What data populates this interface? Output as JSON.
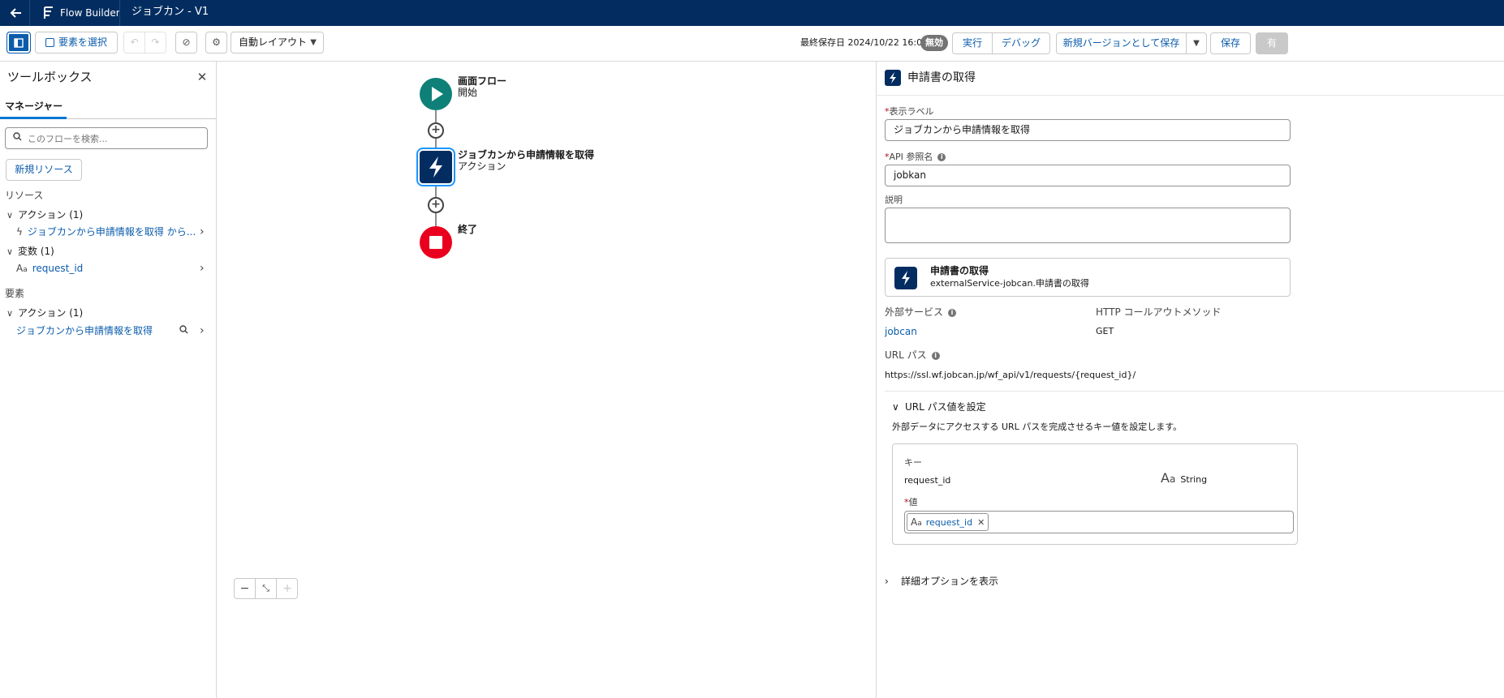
{
  "header": {
    "back_icon": "arrow-left-icon",
    "app_name": "Flow Builder",
    "flow_title": "ジョブカン - V1"
  },
  "toolbar": {
    "select_elements": "要素を選択",
    "layout_mode": "自動レイアウト",
    "last_saved": "最終保存日 2024/10/22 16:04",
    "status_badge": "無効",
    "run": "実行",
    "debug": "デバッグ",
    "save_as_new_version": "新規バージョンとして保存",
    "save": "保存",
    "activate": "有"
  },
  "toolbox": {
    "title": "ツールボックス",
    "tab_manager": "マネージャー",
    "search_placeholder": "このフローを検索...",
    "new_resource": "新規リソース",
    "resources_label": "リソース",
    "resource_groups": [
      {
        "label": "アクション (1)",
        "items": [
          {
            "label": "ジョブカンから申請情報を取得 から..."
          }
        ]
      },
      {
        "label": "変数 (1)",
        "items": [
          {
            "label": "request_id"
          }
        ]
      }
    ],
    "elements_label": "要素",
    "element_groups": [
      {
        "label": "アクション (1)",
        "items": [
          {
            "label": "ジョブカンから申請情報を取得"
          }
        ]
      }
    ]
  },
  "canvas": {
    "nodes": [
      {
        "title": "画面フロー",
        "subtitle": "開始"
      },
      {
        "title": "ジョブカンから申請情報を取得",
        "subtitle": "アクション"
      },
      {
        "title": "終了",
        "subtitle": ""
      }
    ]
  },
  "panel": {
    "title": "申請書の取得",
    "label_field": {
      "label": "表示ラベル",
      "value": "ジョブカンから申請情報を取得"
    },
    "api_field": {
      "label": "API 参照名",
      "value": "jobkan"
    },
    "description_field": {
      "label": "説明",
      "value": ""
    },
    "action_card": {
      "title": "申請書の取得",
      "subtitle": "externalService-jobcan.申請書の取得"
    },
    "external_service_label": "外部サービス",
    "external_service_value": "jobcan",
    "http_method_label": "HTTP コールアウトメソッド",
    "http_method_value": "GET",
    "url_path_label": "URL パス",
    "url_path_value": "https://ssl.wf.jobcan.jp/wf_api/v1/requests/{request_id}/",
    "url_section_title": "URL パス値を設定",
    "url_section_desc": "外部データにアクセスする URL パスを完成させるキー値を設定します。",
    "key_label": "キー",
    "key_value": "request_id",
    "type_value": "String",
    "value_label": "値",
    "value_pill": "request_id",
    "advanced_options": "詳細オプションを表示"
  },
  "colors": {
    "header_bg": "#032d60",
    "start_node": "#0e8078",
    "action_node": "#032d60",
    "end_node": "#ea001e",
    "link": "#0b5cab",
    "badge_inactive": "#747474"
  }
}
